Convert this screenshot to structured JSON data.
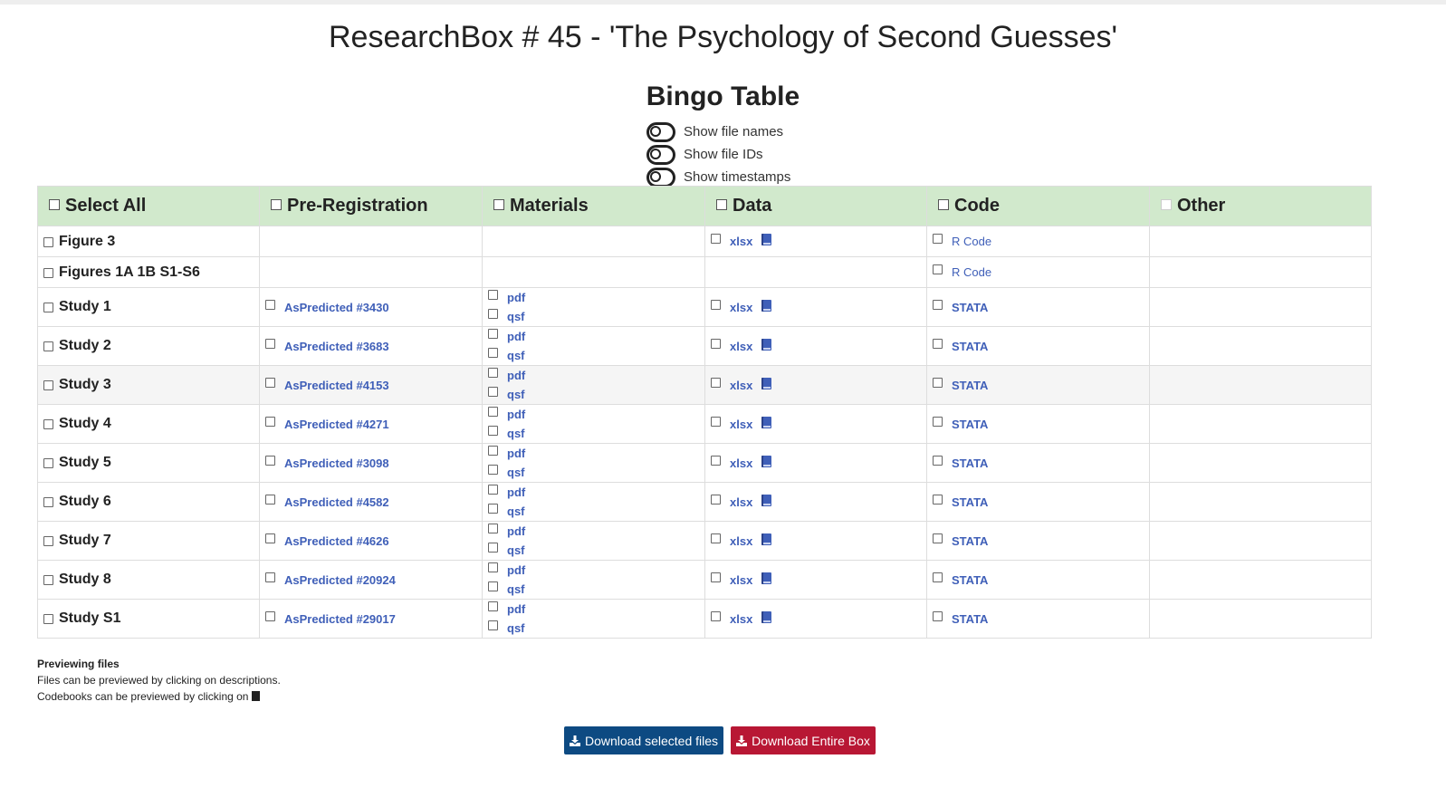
{
  "page_title": "ResearchBox # 45 - 'The Psychology of Second Guesses'",
  "section_title": "Bingo Table",
  "toggles": [
    {
      "label": "Show file names",
      "on": false
    },
    {
      "label": "Show file IDs",
      "on": false
    },
    {
      "label": "Show timestamps",
      "on": false
    }
  ],
  "table": {
    "headers": {
      "select_all": "Select All",
      "pre_registration": "Pre-Registration",
      "materials": "Materials",
      "data": "Data",
      "code": "Code",
      "other": "Other"
    },
    "rows": [
      {
        "label": "Figure 3",
        "prereg": "",
        "materials": [],
        "data": "xlsx",
        "code": "R Code"
      },
      {
        "label": "Figures 1A 1B S1-S6",
        "prereg": "",
        "materials": [],
        "data": "",
        "code": "R Code"
      },
      {
        "label": "Study 1",
        "prereg": "AsPredicted #3430",
        "materials": [
          "pdf",
          "qsf"
        ],
        "data": "xlsx",
        "code": "STATA"
      },
      {
        "label": "Study 2",
        "prereg": "AsPredicted #3683",
        "materials": [
          "pdf",
          "qsf"
        ],
        "data": "xlsx",
        "code": "STATA"
      },
      {
        "label": "Study 3",
        "prereg": "AsPredicted #4153",
        "materials": [
          "pdf",
          "qsf"
        ],
        "data": "xlsx",
        "code": "STATA"
      },
      {
        "label": "Study 4",
        "prereg": "AsPredicted #4271",
        "materials": [
          "pdf",
          "qsf"
        ],
        "data": "xlsx",
        "code": "STATA"
      },
      {
        "label": "Study 5",
        "prereg": "AsPredicted #3098",
        "materials": [
          "pdf",
          "qsf"
        ],
        "data": "xlsx",
        "code": "STATA"
      },
      {
        "label": "Study 6",
        "prereg": "AsPredicted #4582",
        "materials": [
          "pdf",
          "qsf"
        ],
        "data": "xlsx",
        "code": "STATA"
      },
      {
        "label": "Study 7",
        "prereg": "AsPredicted #4626",
        "materials": [
          "pdf",
          "qsf"
        ],
        "data": "xlsx",
        "code": "STATA"
      },
      {
        "label": "Study 8",
        "prereg": "AsPredicted #20924",
        "materials": [
          "pdf",
          "qsf"
        ],
        "data": "xlsx",
        "code": "STATA"
      },
      {
        "label": "Study S1",
        "prereg": "AsPredicted #29017",
        "materials": [
          "pdf",
          "qsf"
        ],
        "data": "xlsx",
        "code": "STATA"
      }
    ]
  },
  "notes": {
    "title": "Previewing files",
    "line1": "Files can be previewed by clicking on descriptions.",
    "line2": "Codebooks can be previewed by clicking on"
  },
  "buttons": {
    "download_selected": "Download selected files",
    "download_entire": "Download Entire Box"
  },
  "colors": {
    "header_bg": "#d1e9cc",
    "link": "#3f5fb8",
    "btn_blue": "#0d4a82",
    "btn_red": "#b81734"
  },
  "icons": {
    "codebook": "book-icon",
    "download": "download-icon",
    "toggle": "toggle-switch-icon"
  }
}
